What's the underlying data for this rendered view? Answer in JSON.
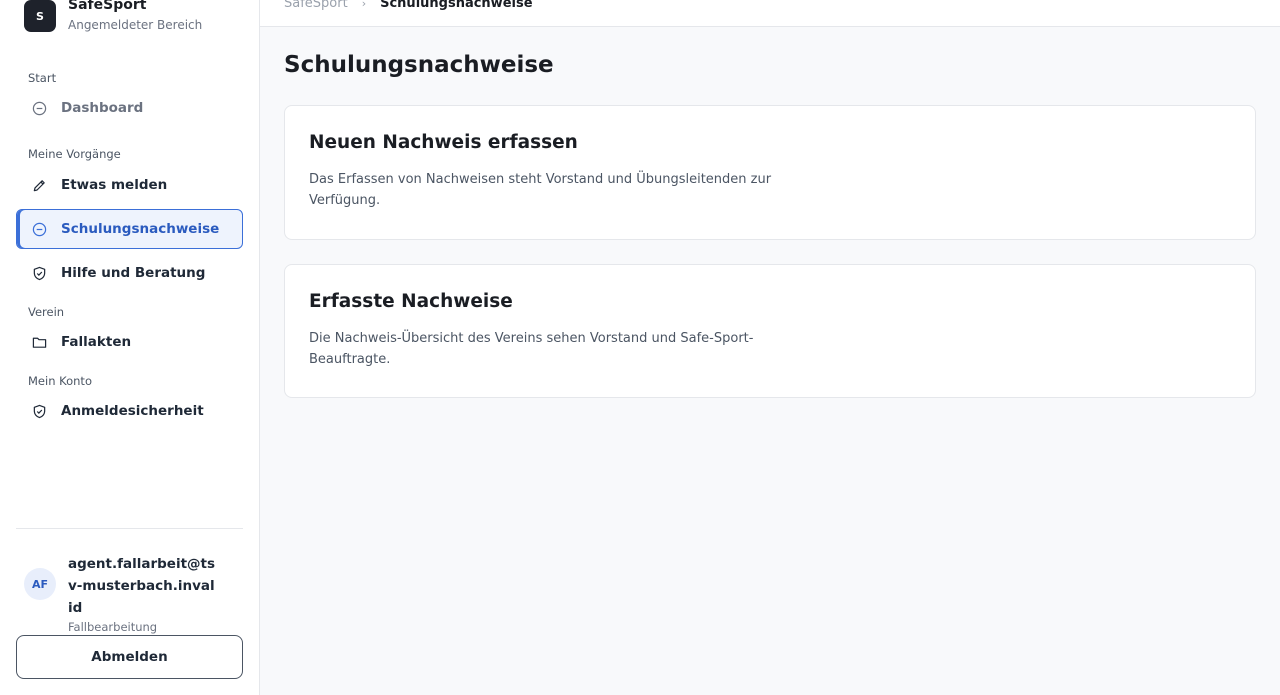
{
  "brand": {
    "logo_letter": "S",
    "title": "SafeSport",
    "subtitle": "Angemeldeter Bereich"
  },
  "sidebar": {
    "sections": [
      {
        "label": "Start",
        "items": [
          {
            "label": "Dashboard",
            "icon": "minus-circle-icon",
            "state": "muted"
          }
        ]
      },
      {
        "label": "Meine Vorgänge",
        "items": [
          {
            "label": "Etwas melden",
            "icon": "pencil-icon",
            "state": "normal"
          },
          {
            "label": "Schulungsnachweise",
            "icon": "minus-circle-icon",
            "state": "active"
          },
          {
            "label": "Hilfe und Beratung",
            "icon": "shield-check-icon",
            "state": "normal"
          }
        ]
      },
      {
        "label": "Verein",
        "items": [
          {
            "label": "Fallakten",
            "icon": "folder-icon",
            "state": "normal"
          }
        ]
      },
      {
        "label": "Mein Konto",
        "items": [
          {
            "label": "Anmeldesicherheit",
            "icon": "shield-check-icon",
            "state": "normal"
          }
        ]
      }
    ]
  },
  "user": {
    "initials": "AF",
    "email": "agent.fallarbeit@tsv-musterbach.invalid",
    "role": "Fallbearbeitung"
  },
  "logout_label": "Abmelden",
  "breadcrumb": {
    "root": "SafeSport",
    "separator": "›",
    "current": "Schulungsnachweise"
  },
  "page": {
    "title": "Schulungsnachweise",
    "cards": [
      {
        "title": "Neuen Nachweis erfassen",
        "text": "Das Erfassen von Nachweisen steht Vorstand und Übungsleitenden zur Verfügung."
      },
      {
        "title": "Erfasste Nachweise",
        "text": "Die Nachweis-Übersicht des Vereins sehen Vorstand und Safe-Sport-Beauftragte."
      }
    ]
  },
  "colors": {
    "accent": "#3b6fd8",
    "active_bg": "#eef3fd",
    "logo_bg": "#1e222b"
  }
}
